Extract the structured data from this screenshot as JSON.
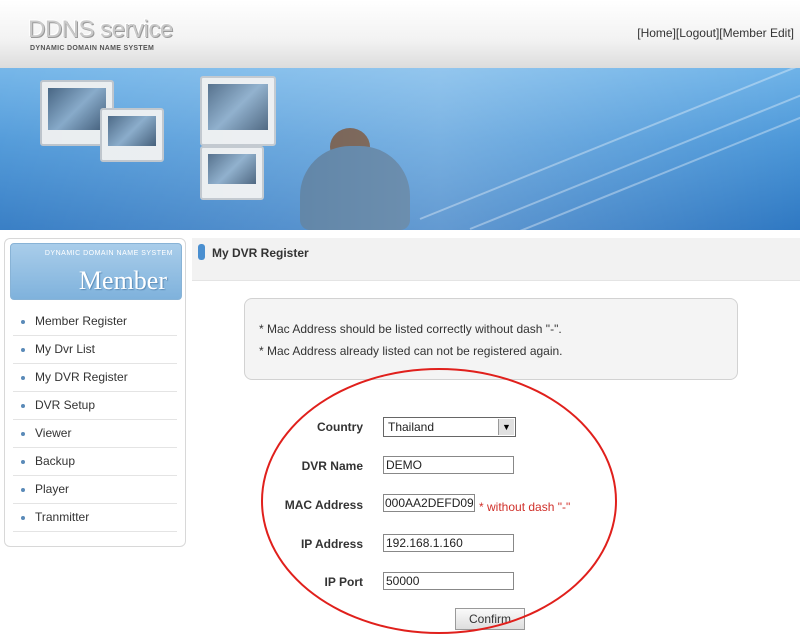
{
  "header": {
    "logo_title": "DDNS service",
    "logo_subtitle": "DYNAMIC DOMAIN NAME SYSTEM",
    "links": [
      "[Home]",
      "[Logout]",
      "[Member Edit]"
    ]
  },
  "sidebar": {
    "small_caption": "DYNAMIC DOMAIN NAME SYSTEM",
    "title": "Member",
    "items": [
      {
        "label": "Member Register"
      },
      {
        "label": "My Dvr List"
      },
      {
        "label": "My DVR Register"
      },
      {
        "label": "DVR Setup"
      },
      {
        "label": "Viewer"
      },
      {
        "label": "Backup"
      },
      {
        "label": "Player"
      },
      {
        "label": "Tranmitter"
      }
    ]
  },
  "main": {
    "page_title": "My DVR Register",
    "notices": [
      "* Mac Address should be listed correctly without dash \"-\".",
      "* Mac Address already listed can not be registered again."
    ],
    "form": {
      "country": {
        "label": "Country",
        "value": "Thailand"
      },
      "dvr_name": {
        "label": "DVR Name",
        "value": "DEMO"
      },
      "mac_address": {
        "label": "MAC Address",
        "value": "000AA2DEFD09",
        "hint": "* without dash \"-\""
      },
      "ip_address": {
        "label": "IP Address",
        "value": "192.168.1.160"
      },
      "ip_port": {
        "label": "IP Port",
        "value": "50000"
      },
      "confirm_label": "Confirm"
    }
  },
  "colors": {
    "accent_blue": "#4a8fd0",
    "hint_red": "#d0302a",
    "highlight_red": "#e0201c"
  }
}
